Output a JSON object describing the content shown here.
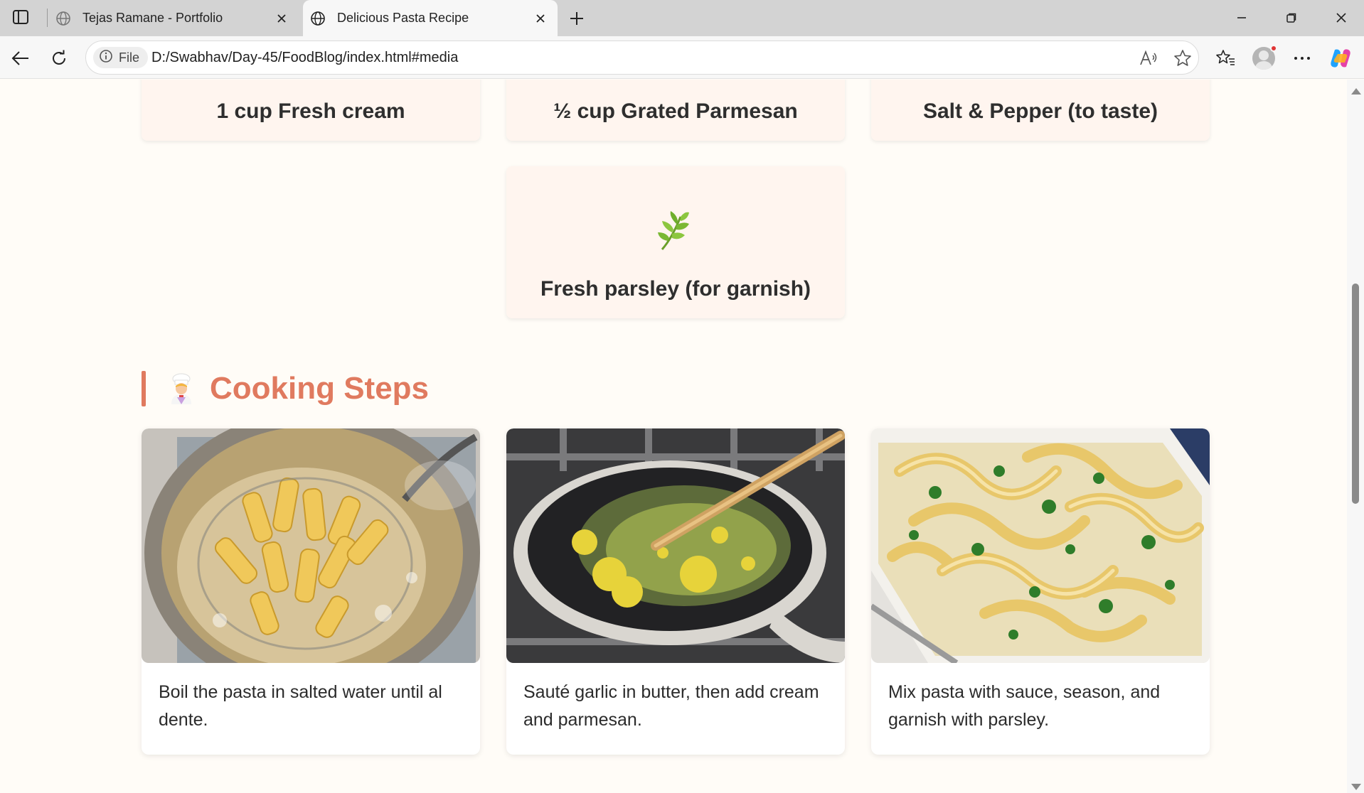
{
  "browser": {
    "tabs": [
      {
        "title": "Tejas Ramane - Portfolio",
        "active": false
      },
      {
        "title": "Delicious Pasta Recipe",
        "active": true
      }
    ],
    "address": {
      "chip_label": "File",
      "url": "D:/Swabhav/Day-45/FoodBlog/index.html#media"
    },
    "icons": [
      "sidebar-icon",
      "globe-icon",
      "close-icon",
      "plus-icon",
      "minimize-icon",
      "restore-icon",
      "back-icon",
      "refresh-icon",
      "info-icon",
      "read-aloud-icon",
      "star-icon",
      "favorites-icon",
      "profile-icon",
      "more-icon",
      "copilot-icon"
    ]
  },
  "ingredients": {
    "visible": [
      "1 cup Fresh cream",
      "½ cup Grated Parmesan",
      "Salt & Pepper (to taste)",
      "Fresh parsley (for garnish)"
    ],
    "garnish_icon": "herb-icon"
  },
  "steps_section": {
    "title": "Cooking Steps",
    "icon": "chef-icon",
    "accent": "#e07a5f",
    "steps": [
      {
        "text": "Boil the pasta in salted water until al dente.",
        "image": "pasta-boiling-photo"
      },
      {
        "text": "Sauté garlic in butter, then add cream and parmesan.",
        "image": "garlic-butter-pan-photo"
      },
      {
        "text": "Mix pasta with sauce, season, and garnish with parsley.",
        "image": "finished-fettuccine-photo"
      }
    ]
  }
}
